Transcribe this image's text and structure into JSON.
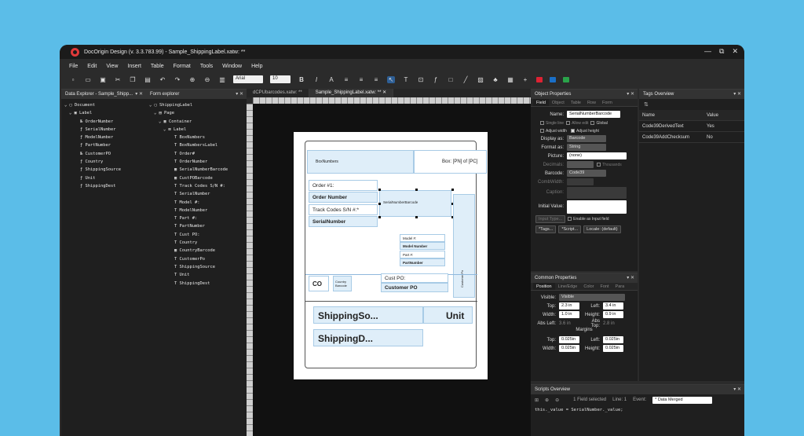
{
  "window": {
    "title": "DocOrigin Design (v. 3.3.783.99) - Sample_ShippingLabel.xatw: **",
    "controls": [
      "—",
      "⧉",
      "✕"
    ]
  },
  "menu": [
    "File",
    "Edit",
    "View",
    "Insert",
    "Table",
    "Format",
    "Tools",
    "Window",
    "Help"
  ],
  "toolbar": {
    "font": "Arial",
    "size": "10"
  },
  "data_explorer": {
    "title": "Data Explorer - Sample_Shipp...",
    "items": [
      "Document",
      "Label",
      "OrderNumber",
      "SerialNumber",
      "ModelNumber",
      "PartNumber",
      "CustomerPO",
      "Country",
      "ShippingSource",
      "Unit",
      "ShippingDest"
    ]
  },
  "form_explorer": {
    "title": "Form explorer",
    "items": [
      "ShippingLabel",
      "Page",
      "Container",
      "Label",
      "BoxNumbers",
      "BoxNumbersLabel",
      "Order#",
      "OrderNumber",
      "SerialNumberBarcode",
      "CustPOBarcode",
      "Track Codes S/N #:",
      "SerialNumber",
      "Model #:",
      "ModelNumber",
      "Part #:",
      "PartNumber",
      "Cust PO:",
      "Country",
      "CountryBarcode",
      "CustomerPo",
      "ShippingSource",
      "Unit",
      "ShippingDest"
    ]
  },
  "doc_tabs": [
    "dCPUbarcodes.xatw: **",
    "Sample_ShippingLabel.xatw: **"
  ],
  "label": {
    "box_numbers": "BoxNumbers",
    "box_text": "Box: [PN] of [PC]",
    "order_label": "Order #1:",
    "order_number": "Order Number",
    "track_label": "Track Codes S/N #:*",
    "serial_number": "SerialNumber",
    "serial_barcode": "SerialNumberBarcode",
    "model_label": "Model #:",
    "model_number": "Model Number",
    "part_label": "Part #:",
    "part_number": "PartNumber",
    "co": "CO",
    "country_barcode": "Country Barcode",
    "cust_po_label": "Cust PO:",
    "customer_po": "Customer PO",
    "customer_po_vert": "CustomerPo",
    "shipping_source": "ShippingSo...",
    "unit": "Unit",
    "shipping_dest": "ShippingD..."
  },
  "object_properties": {
    "title": "Object Properties",
    "tabs": [
      "Field",
      "Object",
      "Table",
      "Row",
      "Form"
    ],
    "name_label": "Name:",
    "name_value": "SerialNumberBarcode",
    "single_line": "Single line",
    "allow_edit": "Allow edit",
    "global": "Global",
    "adjust_width": "Adjust width",
    "adjust_height": "Adjust height",
    "display_as_label": "Display as:",
    "display_as": "Barcode",
    "format_as_label": "Format as:",
    "format_as": "String",
    "picture_label": "Picture:",
    "picture": "(none)",
    "decimals_label": "Decimals:",
    "thousands": "Thousands",
    "barcode_label": "Barcode:",
    "barcode": "Code39",
    "comb_label": "CombWidth:",
    "caption_label": "Caption:",
    "initial_label": "Initial Value:",
    "input_type": "Input Type...",
    "enable_input": "Enable as Input field",
    "tags_btn": "*Tags...",
    "script_btn": "*Script...",
    "locale_btn": "Locale: (default)"
  },
  "common_properties": {
    "title": "Common Properties",
    "tabs": [
      "Position",
      "Line/Edge",
      "Color",
      "Font",
      "Para"
    ],
    "visible_label": "Visible:",
    "visible": "Visible",
    "top_label": "Top:",
    "top": "2.3 in",
    "left_label": "Left:",
    "left": "3.4 in",
    "width_label": "Width:",
    "width": "1.0 in",
    "height_label": "Height:",
    "height": "0.9 in",
    "abs_left_label": "Abs Left:",
    "abs_left": "3.6 in",
    "abs_top_label": "Abs Top:",
    "abs_top": "2.8 in",
    "margins": "Margins",
    "m_top": "0.025in",
    "m_left": "0.025in",
    "m_width": "0.025in",
    "m_height": "0.025in"
  },
  "tags_overview": {
    "title": "Tags Overview",
    "col_name": "Name",
    "col_value": "Value",
    "rows": [
      {
        "name": "Code39DerivedText",
        "value": "Yes"
      },
      {
        "name": "Code39AddChecksum",
        "value": "No"
      }
    ]
  },
  "scripts_overview": {
    "title": "Scripts Overview",
    "selected": "1 Field selected",
    "line": "Line: 1",
    "event_label": "Event:",
    "event": "* Data Merged",
    "code": "this._value = SerialNumber._value;"
  }
}
